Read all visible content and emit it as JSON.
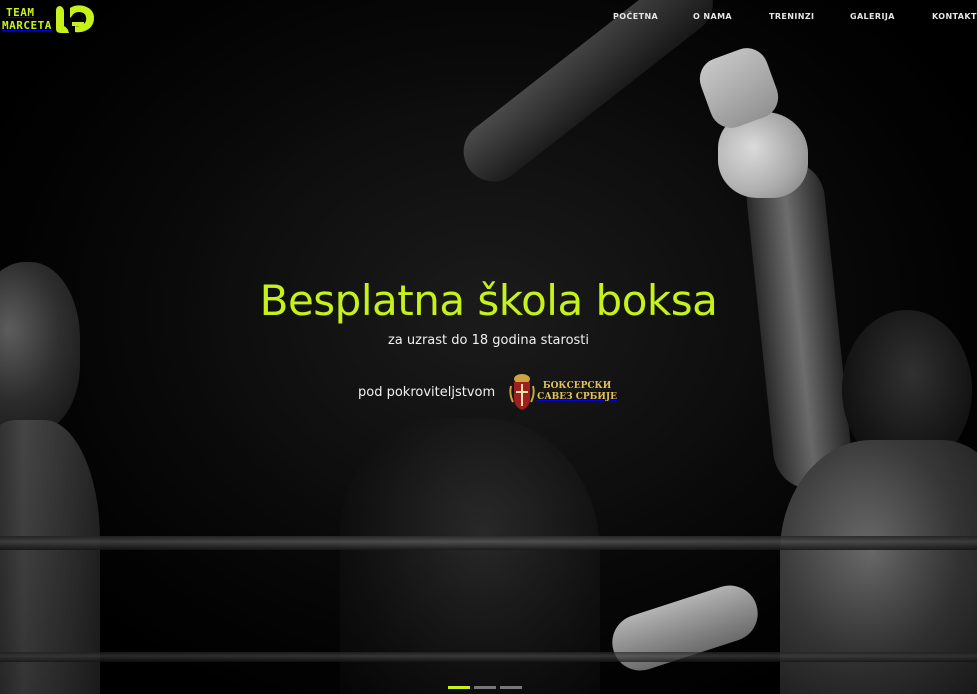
{
  "brand": {
    "logo_line1": "TEAM",
    "logo_line2": "MARCETA",
    "accent_color": "#c6f219"
  },
  "nav": {
    "items": [
      {
        "label": "POČETNA"
      },
      {
        "label": "O NAMA"
      },
      {
        "label": "TRENINZI"
      },
      {
        "label": "GALERIJA"
      },
      {
        "label": "KONTAKT"
      }
    ]
  },
  "hero": {
    "title": "Besplatna škola boksa",
    "subtitle": "za uzrast do 18 godina starosti",
    "patron_label": "pod pokroviteljstvom",
    "federation_line1": "БОКСЕРСКИ",
    "federation_line2": "САВЕЗ СРБИЈЕ",
    "federation_color": "#e3c15c"
  },
  "slider": {
    "count": 3,
    "active_index": 0
  }
}
